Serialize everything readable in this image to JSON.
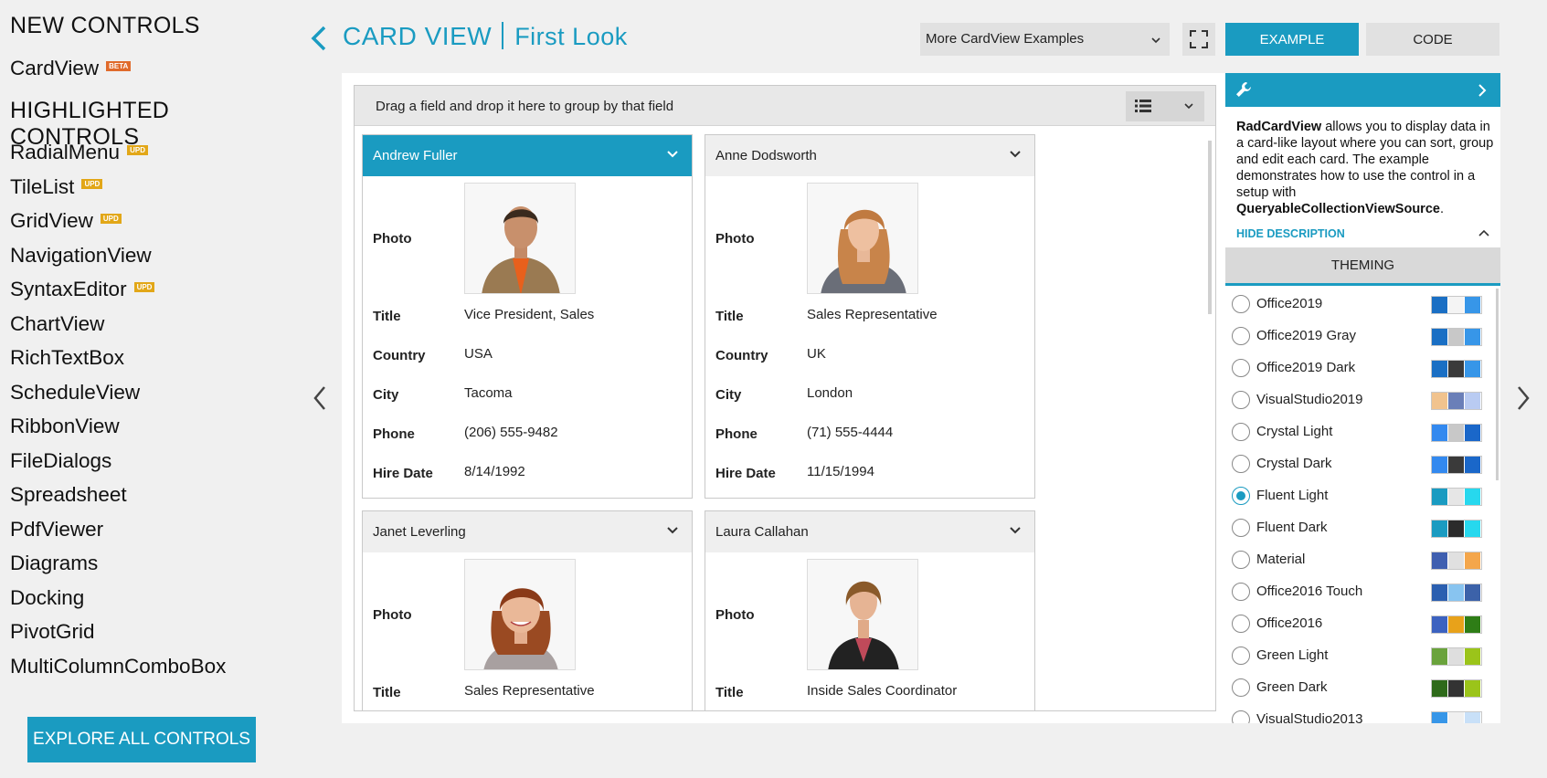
{
  "sidebar": {
    "new_title": "NEW CONTROLS",
    "new_items": [
      {
        "label": "CardView",
        "tag": "BETA"
      }
    ],
    "highlighted_title": "HIGHLIGHTED CONTROLS",
    "items": [
      {
        "label": "RadialMenu",
        "tag": "UPD"
      },
      {
        "label": "TileList",
        "tag": "UPD"
      },
      {
        "label": "GridView",
        "tag": "UPD"
      },
      {
        "label": "NavigationView",
        "tag": ""
      },
      {
        "label": "SyntaxEditor",
        "tag": "UPD"
      },
      {
        "label": "ChartView",
        "tag": ""
      },
      {
        "label": "RichTextBox",
        "tag": ""
      },
      {
        "label": "ScheduleView",
        "tag": ""
      },
      {
        "label": "RibbonView",
        "tag": ""
      },
      {
        "label": "FileDialogs",
        "tag": ""
      },
      {
        "label": "Spreadsheet",
        "tag": ""
      },
      {
        "label": "PdfViewer",
        "tag": ""
      },
      {
        "label": "Diagrams",
        "tag": ""
      },
      {
        "label": "Docking",
        "tag": ""
      },
      {
        "label": "PivotGrid",
        "tag": ""
      },
      {
        "label": "MultiColumnComboBox",
        "tag": ""
      }
    ],
    "explore_label": "EXPLORE ALL CONTROLS"
  },
  "header": {
    "title": "CARD VIEW",
    "subtitle": "First Look",
    "more_examples": "More CardView Examples",
    "tab_example": "EXAMPLE",
    "tab_code": "CODE"
  },
  "cardview": {
    "group_hint": "Drag a field and drop it here to group by that field",
    "field_labels": {
      "photo": "Photo",
      "title": "Title",
      "country": "Country",
      "city": "City",
      "phone": "Phone",
      "hire_date": "Hire Date"
    },
    "cards": [
      {
        "name": "Andrew  Fuller",
        "title": "Vice President, Sales",
        "country": "USA",
        "city": "Tacoma",
        "phone": "(206) 555-9482",
        "hire_date": "8/14/1992",
        "selected": true
      },
      {
        "name": "Anne  Dodsworth",
        "title": "Sales Representative",
        "country": "UK",
        "city": "London",
        "phone": "(71) 555-4444",
        "hire_date": "11/15/1994",
        "selected": false
      },
      {
        "name": "Janet  Leverling",
        "title": "Sales Representative",
        "selected": false
      },
      {
        "name": "Laura  Callahan",
        "title": "Inside Sales Coordinator",
        "selected": false
      }
    ]
  },
  "config": {
    "description_bold": "RadCardView",
    "description_text": " allows you to display data in a card-like layout where you can sort, group and edit each card. The example demonstrates how to use the control in a setup with ",
    "description_bold2": "QueryableCollectionViewSource",
    "description_end": ".",
    "hide_description": "HIDE DESCRIPTION",
    "theming_label": "THEMING",
    "themes": [
      {
        "name": "Office2019",
        "colors": [
          "#1a6fc4",
          "#f4f4f4",
          "#3796e8"
        ],
        "selected": false
      },
      {
        "name": "Office2019 Gray",
        "colors": [
          "#1a6fc4",
          "#c8c8c8",
          "#3796e8"
        ],
        "selected": false
      },
      {
        "name": "Office2019 Dark",
        "colors": [
          "#1a6fc4",
          "#3a3a3a",
          "#3796e8"
        ],
        "selected": false
      },
      {
        "name": "VisualStudio2019",
        "colors": [
          "#f1c38e",
          "#6a7fb8",
          "#b9cbf2"
        ],
        "selected": false
      },
      {
        "name": "Crystal Light",
        "colors": [
          "#3389ef",
          "#c8c8c8",
          "#1a67c9"
        ],
        "selected": false
      },
      {
        "name": "Crystal Dark",
        "colors": [
          "#3389ef",
          "#3a3a3a",
          "#1a67c9"
        ],
        "selected": false
      },
      {
        "name": "Fluent Light",
        "colors": [
          "#1a9bc1",
          "#e6e6e6",
          "#27d8ee"
        ],
        "selected": true
      },
      {
        "name": "Fluent Dark",
        "colors": [
          "#1a9bc1",
          "#2b2b2b",
          "#27d8ee"
        ],
        "selected": false
      },
      {
        "name": "Material",
        "colors": [
          "#3f5fb0",
          "#e0e0e0",
          "#f4a64b"
        ],
        "selected": false
      },
      {
        "name": "Office2016 Touch",
        "colors": [
          "#2b5fb0",
          "#88c4f0",
          "#3c62a9"
        ],
        "selected": false
      },
      {
        "name": "Office2016",
        "colors": [
          "#3c62c0",
          "#e8a21a",
          "#2e7d16"
        ],
        "selected": false
      },
      {
        "name": "Green Light",
        "colors": [
          "#6aa33c",
          "#dedede",
          "#9bc41a"
        ],
        "selected": false
      },
      {
        "name": "Green Dark",
        "colors": [
          "#2e6a1a",
          "#333333",
          "#9bc41a"
        ],
        "selected": false
      },
      {
        "name": "VisualStudio2013",
        "colors": [
          "#3796e8",
          "#f0f0f0",
          "#c8e0f8"
        ],
        "selected": false
      }
    ]
  },
  "icons": {
    "back": "chevron-left-icon",
    "fullscreen": "fullscreen-icon",
    "wrench": "wrench-icon",
    "collapse": "chevron-right-icon",
    "list_view": "list-icon"
  }
}
